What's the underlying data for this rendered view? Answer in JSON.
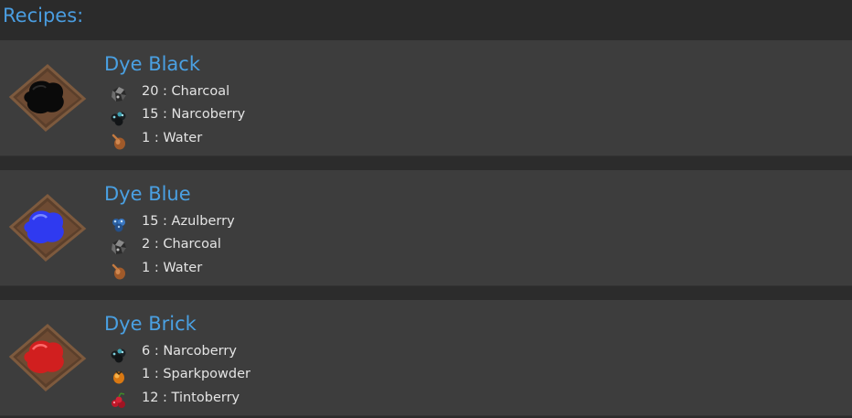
{
  "header": {
    "title": "Recipes:"
  },
  "recipes": [
    {
      "name": "Dye Black",
      "dye_color": "#0a0a0a",
      "ingredients": [
        {
          "text": "20 : Charcoal",
          "icon": "charcoal-icon"
        },
        {
          "text": "15 : Narcoberry",
          "icon": "narcoberry-icon"
        },
        {
          "text": "1 : Water",
          "icon": "water-icon"
        }
      ]
    },
    {
      "name": "Dye Blue",
      "dye_color": "#2f3af0",
      "ingredients": [
        {
          "text": "15 : Azulberry",
          "icon": "azulberry-icon"
        },
        {
          "text": "2 : Charcoal",
          "icon": "charcoal-icon"
        },
        {
          "text": "1 : Water",
          "icon": "water-icon"
        }
      ]
    },
    {
      "name": "Dye Brick",
      "dye_color": "#d11f1f",
      "ingredients": [
        {
          "text": "6 : Narcoberry",
          "icon": "narcoberry-icon"
        },
        {
          "text": "1 : Sparkpowder",
          "icon": "sparkpowder-icon"
        },
        {
          "text": "12 : Tintoberry",
          "icon": "tintoberry-icon"
        }
      ]
    }
  ]
}
